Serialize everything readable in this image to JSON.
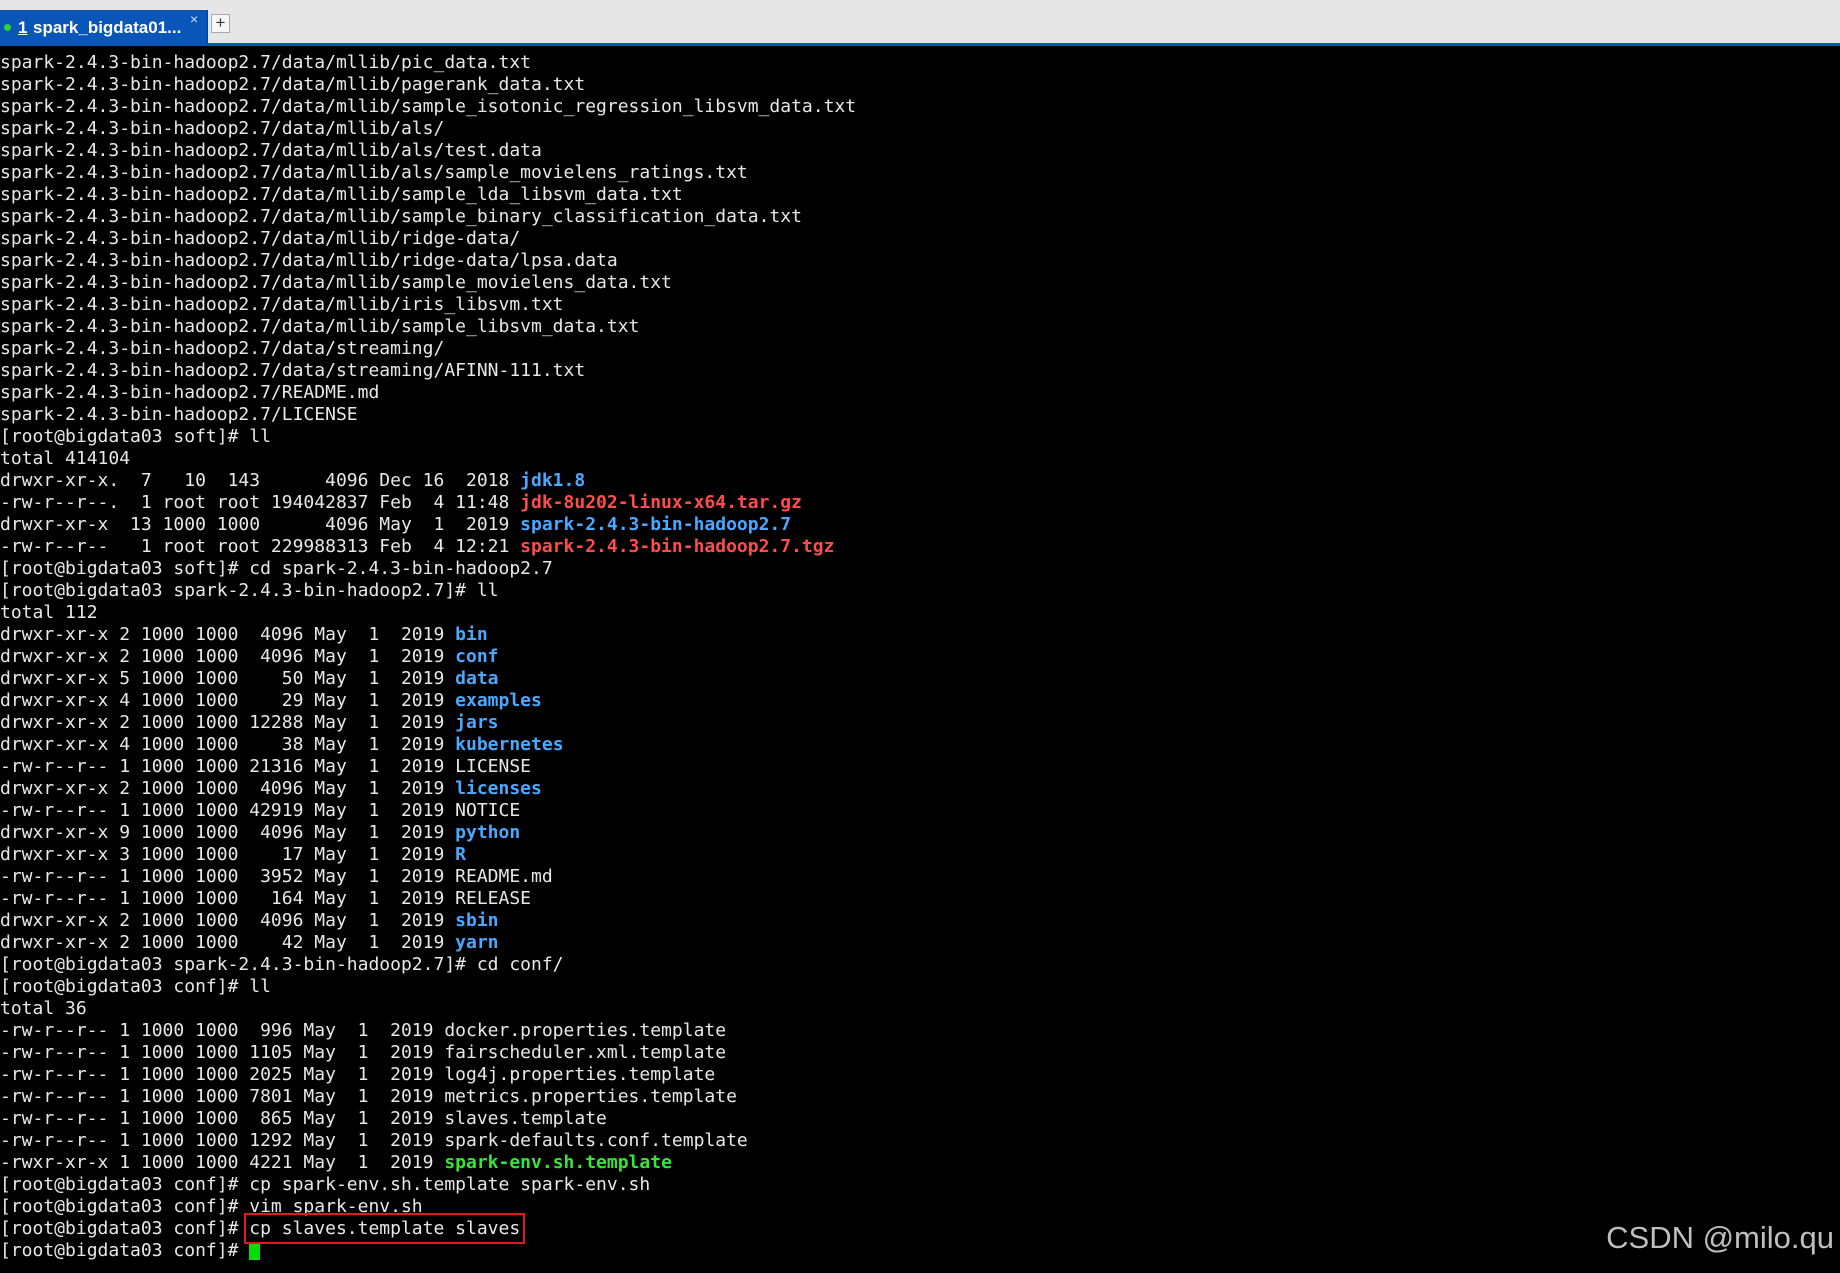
{
  "tab_bar": {
    "tab_number": "1",
    "tab_title": "spark_bigdata01...",
    "tab_close": "×",
    "add_tab": "+"
  },
  "terminal": {
    "lines": [
      [
        {
          "t": "spark-2.4.3-bin-hadoop2.7/data/mllib/pic_data.txt"
        }
      ],
      [
        {
          "t": "spark-2.4.3-bin-hadoop2.7/data/mllib/pagerank_data.txt"
        }
      ],
      [
        {
          "t": "spark-2.4.3-bin-hadoop2.7/data/mllib/sample_isotonic_regression_libsvm_data.txt"
        }
      ],
      [
        {
          "t": "spark-2.4.3-bin-hadoop2.7/data/mllib/als/"
        }
      ],
      [
        {
          "t": "spark-2.4.3-bin-hadoop2.7/data/mllib/als/test.data"
        }
      ],
      [
        {
          "t": "spark-2.4.3-bin-hadoop2.7/data/mllib/als/sample_movielens_ratings.txt"
        }
      ],
      [
        {
          "t": "spark-2.4.3-bin-hadoop2.7/data/mllib/sample_lda_libsvm_data.txt"
        }
      ],
      [
        {
          "t": "spark-2.4.3-bin-hadoop2.7/data/mllib/sample_binary_classification_data.txt"
        }
      ],
      [
        {
          "t": "spark-2.4.3-bin-hadoop2.7/data/mllib/ridge-data/"
        }
      ],
      [
        {
          "t": "spark-2.4.3-bin-hadoop2.7/data/mllib/ridge-data/lpsa.data"
        }
      ],
      [
        {
          "t": "spark-2.4.3-bin-hadoop2.7/data/mllib/sample_movielens_data.txt"
        }
      ],
      [
        {
          "t": "spark-2.4.3-bin-hadoop2.7/data/mllib/iris_libsvm.txt"
        }
      ],
      [
        {
          "t": "spark-2.4.3-bin-hadoop2.7/data/mllib/sample_libsvm_data.txt"
        }
      ],
      [
        {
          "t": "spark-2.4.3-bin-hadoop2.7/data/streaming/"
        }
      ],
      [
        {
          "t": "spark-2.4.3-bin-hadoop2.7/data/streaming/AFINN-111.txt"
        }
      ],
      [
        {
          "t": "spark-2.4.3-bin-hadoop2.7/README.md"
        }
      ],
      [
        {
          "t": "spark-2.4.3-bin-hadoop2.7/LICENSE"
        }
      ],
      [
        {
          "t": "[root@bigdata03 soft]# ll"
        }
      ],
      [
        {
          "t": "total 414104"
        }
      ],
      [
        {
          "t": "drwxr-xr-x.  7   10  143      4096 Dec 16  2018 "
        },
        {
          "t": "jdk1.8",
          "c": "dir"
        }
      ],
      [
        {
          "t": "-rw-r--r--.  1 root root 194042837 Feb  4 11:48 "
        },
        {
          "t": "jdk-8u202-linux-x64.tar.gz",
          "c": "arch"
        }
      ],
      [
        {
          "t": "drwxr-xr-x  13 1000 1000      4096 May  1  2019 "
        },
        {
          "t": "spark-2.4.3-bin-hadoop2.7",
          "c": "dir"
        }
      ],
      [
        {
          "t": "-rw-r--r--   1 root root 229988313 Feb  4 12:21 "
        },
        {
          "t": "spark-2.4.3-bin-hadoop2.7.tgz",
          "c": "arch"
        }
      ],
      [
        {
          "t": "[root@bigdata03 soft]# cd spark-2.4.3-bin-hadoop2.7"
        }
      ],
      [
        {
          "t": "[root@bigdata03 spark-2.4.3-bin-hadoop2.7]# ll"
        }
      ],
      [
        {
          "t": "total 112"
        }
      ],
      [
        {
          "t": "drwxr-xr-x 2 1000 1000  4096 May  1  2019 "
        },
        {
          "t": "bin",
          "c": "dir"
        }
      ],
      [
        {
          "t": "drwxr-xr-x 2 1000 1000  4096 May  1  2019 "
        },
        {
          "t": "conf",
          "c": "dir"
        }
      ],
      [
        {
          "t": "drwxr-xr-x 5 1000 1000    50 May  1  2019 "
        },
        {
          "t": "data",
          "c": "dir"
        }
      ],
      [
        {
          "t": "drwxr-xr-x 4 1000 1000    29 May  1  2019 "
        },
        {
          "t": "examples",
          "c": "dir"
        }
      ],
      [
        {
          "t": "drwxr-xr-x 2 1000 1000 12288 May  1  2019 "
        },
        {
          "t": "jars",
          "c": "dir"
        }
      ],
      [
        {
          "t": "drwxr-xr-x 4 1000 1000    38 May  1  2019 "
        },
        {
          "t": "kubernetes",
          "c": "dir"
        }
      ],
      [
        {
          "t": "-rw-r--r-- 1 1000 1000 21316 May  1  2019 LICENSE"
        }
      ],
      [
        {
          "t": "drwxr-xr-x 2 1000 1000  4096 May  1  2019 "
        },
        {
          "t": "licenses",
          "c": "dir"
        }
      ],
      [
        {
          "t": "-rw-r--r-- 1 1000 1000 42919 May  1  2019 NOTICE"
        }
      ],
      [
        {
          "t": "drwxr-xr-x 9 1000 1000  4096 May  1  2019 "
        },
        {
          "t": "python",
          "c": "dir"
        }
      ],
      [
        {
          "t": "drwxr-xr-x 3 1000 1000    17 May  1  2019 "
        },
        {
          "t": "R",
          "c": "dir"
        }
      ],
      [
        {
          "t": "-rw-r--r-- 1 1000 1000  3952 May  1  2019 README.md"
        }
      ],
      [
        {
          "t": "-rw-r--r-- 1 1000 1000   164 May  1  2019 RELEASE"
        }
      ],
      [
        {
          "t": "drwxr-xr-x 2 1000 1000  4096 May  1  2019 "
        },
        {
          "t": "sbin",
          "c": "dir"
        }
      ],
      [
        {
          "t": "drwxr-xr-x 2 1000 1000    42 May  1  2019 "
        },
        {
          "t": "yarn",
          "c": "dir"
        }
      ],
      [
        {
          "t": "[root@bigdata03 spark-2.4.3-bin-hadoop2.7]# cd conf/"
        }
      ],
      [
        {
          "t": "[root@bigdata03 conf]# ll"
        }
      ],
      [
        {
          "t": "total 36"
        }
      ],
      [
        {
          "t": "-rw-r--r-- 1 1000 1000  996 May  1  2019 docker.properties.template"
        }
      ],
      [
        {
          "t": "-rw-r--r-- 1 1000 1000 1105 May  1  2019 fairscheduler.xml.template"
        }
      ],
      [
        {
          "t": "-rw-r--r-- 1 1000 1000 2025 May  1  2019 log4j.properties.template"
        }
      ],
      [
        {
          "t": "-rw-r--r-- 1 1000 1000 7801 May  1  2019 metrics.properties.template"
        }
      ],
      [
        {
          "t": "-rw-r--r-- 1 1000 1000  865 May  1  2019 slaves.template"
        }
      ],
      [
        {
          "t": "-rw-r--r-- 1 1000 1000 1292 May  1  2019 spark-defaults.conf.template"
        }
      ],
      [
        {
          "t": "-rwxr-xr-x 1 1000 1000 4221 May  1  2019 "
        },
        {
          "t": "spark-env.sh.template",
          "c": "exe"
        }
      ],
      [
        {
          "t": "[root@bigdata03 conf]# cp spark-env.sh.template spark-env.sh"
        }
      ],
      [
        {
          "t": "[root@bigdata03 conf]# vim spark-env.sh"
        }
      ],
      [
        {
          "t": "[root@bigdata03 conf]# "
        },
        {
          "t": "cp slaves.template slaves",
          "c": "boxed"
        }
      ],
      [
        {
          "t": "[root@bigdata03 conf]# "
        },
        {
          "cursor": true
        }
      ]
    ]
  },
  "watermark": "CSDN @milo.qu",
  "colors": {
    "directory": "#4aa8ff",
    "archive": "#ff4d4d",
    "executable": "#35e635",
    "highlight_box": "#e01a1a",
    "tab_active": "#0a56b8"
  }
}
